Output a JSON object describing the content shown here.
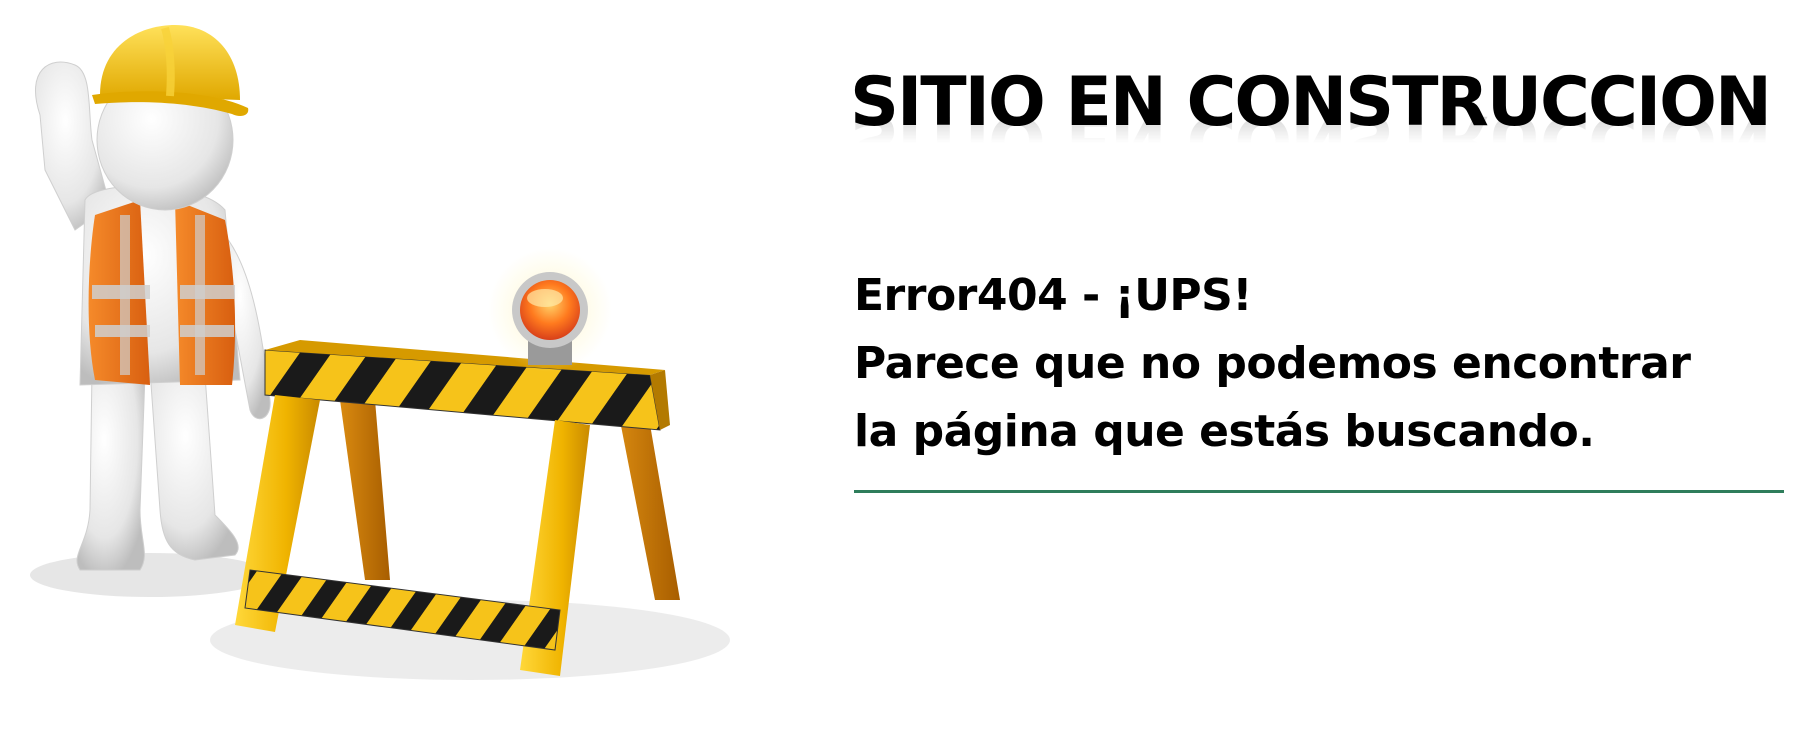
{
  "heading": {
    "title": "SITIO EN CONSTRUCCION"
  },
  "error": {
    "line1": "Error404 - ¡UPS!",
    "line2": "Parece que no podemos encontrar",
    "line3": "la página que estás buscando."
  },
  "colors": {
    "divider": "#2e7d5b",
    "helmet": "#f2c419",
    "vest": "#f07a1e",
    "barrier_yellow": "#f6c31a",
    "barrier_stripe": "#1a1a1a",
    "warning_light": "#f04a1a"
  },
  "illustration": {
    "icon": "construction-worker-barrier-icon"
  }
}
